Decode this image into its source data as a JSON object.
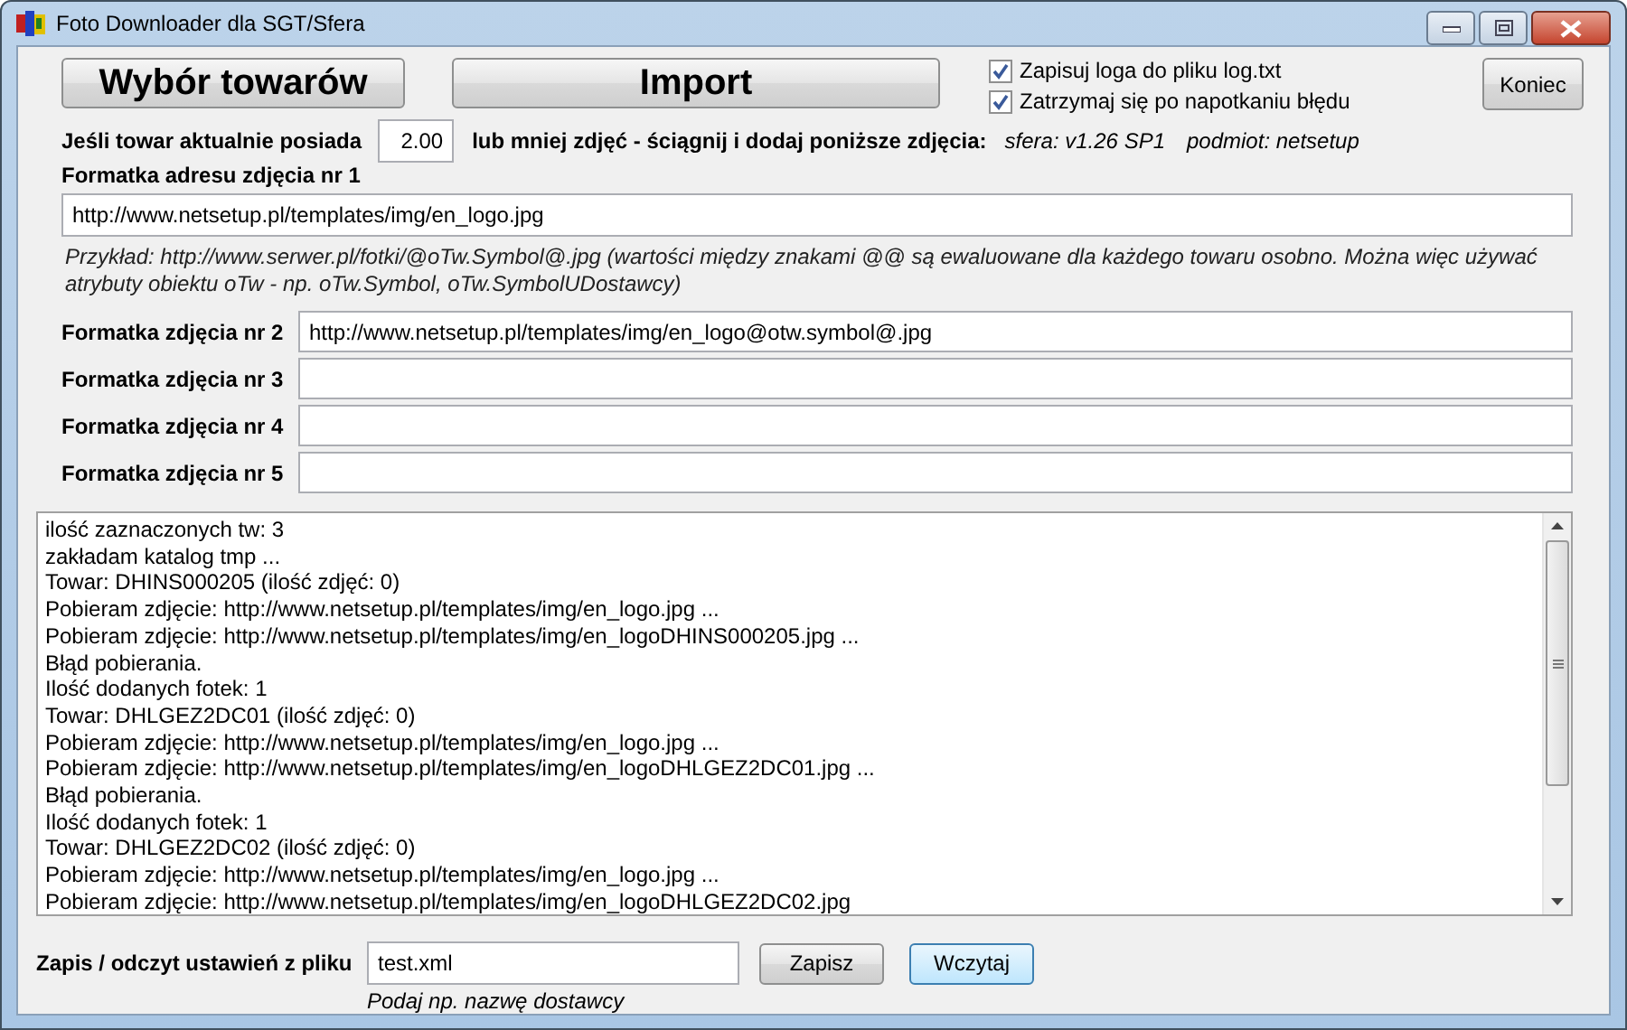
{
  "window": {
    "title": "Foto Downloader dla SGT/Sfera"
  },
  "top_buttons": [
    {
      "label": "Wybór towarów"
    },
    {
      "label": "Import"
    }
  ],
  "options": [
    {
      "label": "Zapisuj loga do pliku log.txt",
      "checked": true
    },
    {
      "label": "Zatrzymaj się po napotkaniu błędu",
      "checked": true
    }
  ],
  "close_button": {
    "label": "Koniec"
  },
  "threshold": {
    "prefix": "Jeśli towar aktualnie posiada",
    "value": "2.00",
    "suffix": "lub mniej zdjęć - ściągnij i dodaj poniższe zdjęcia:"
  },
  "version_info": [
    "sfera: v1.26 SP1",
    "podmiot: netsetup"
  ],
  "format_1": {
    "label": "Formatka adresu zdjęcia nr 1",
    "value": "http://www.netsetup.pl/templates/img/en_logo.jpg"
  },
  "example_text": "Przykład: http://www.serwer.pl/fotki/@oTw.Symbol@.jpg   (wartości między znakami @@ są ewaluowane dla każdego towaru osobno. Można więc używać atrybuty  obiektu oTw - np. oTw.Symbol, oTw.SymbolUDostawcy)",
  "formats": [
    {
      "label": "Formatka zdjęcia nr 2",
      "value": "http://www.netsetup.pl/templates/img/en_logo@otw.symbol@.jpg"
    },
    {
      "label": "Formatka zdjęcia nr 3"
    },
    {
      "label": "Formatka zdjęcia nr 4"
    },
    {
      "label": "Formatka zdjęcia nr 5"
    }
  ],
  "log": {
    "lines": [
      "ilość zaznaczonych tw: 3",
      "zakładam katalog tmp ...",
      "Towar: DHINS000205 (ilość zdjęć: 0)",
      "Pobieram zdjęcie: http://www.netsetup.pl/templates/img/en_logo.jpg ...",
      "Pobieram zdjęcie: http://www.netsetup.pl/templates/img/en_logoDHINS000205.jpg ...",
      "Błąd pobierania.",
      "Ilość dodanych fotek: 1",
      "Towar: DHLGEZ2DC01 (ilość zdjęć: 0)",
      "Pobieram zdjęcie: http://www.netsetup.pl/templates/img/en_logo.jpg ...",
      "Pobieram zdjęcie: http://www.netsetup.pl/templates/img/en_logoDHLGEZ2DC01.jpg ...",
      "Błąd pobierania.",
      "Ilość dodanych fotek: 1",
      "Towar: DHLGEZ2DC02 (ilość zdjęć: 0)",
      "Pobieram zdjęcie: http://www.netsetup.pl/templates/img/en_logo.jpg ...",
      "Pobieram zdjęcie: http://www.netsetup.pl/templates/img/en_logoDHLGEZ2DC02.jpg"
    ]
  },
  "settings_file": {
    "label": "Zapis / odczyt ustawień z pliku",
    "value": "test.xml",
    "hint": "Podaj np. nazwę dostawcy"
  },
  "file_buttons": [
    {
      "label": "Zapisz",
      "focused": false
    },
    {
      "label": "Wczytaj",
      "focused": true
    }
  ]
}
